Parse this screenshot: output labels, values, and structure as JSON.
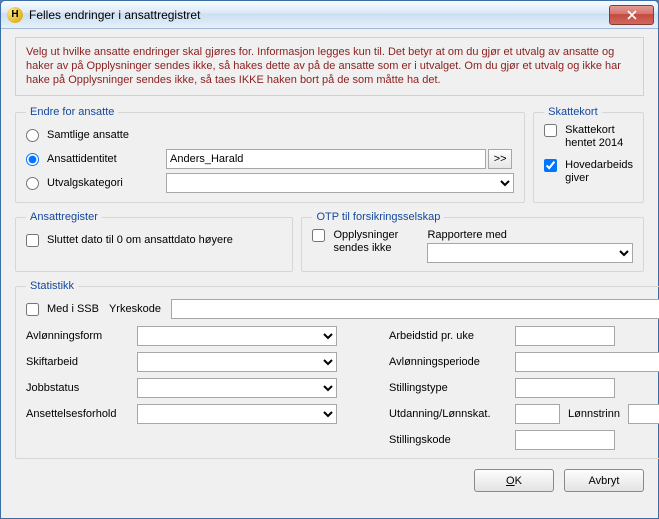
{
  "window": {
    "title": "Felles endringer i ansattregistret",
    "app_icon_letter": "H"
  },
  "info_text": "Velg ut hvilke ansatte endringer skal gjøres for. Informasjon legges kun til. Det betyr at om du gjør et utvalg av ansatte og haker av på Opplysninger sendes ikke, så hakes dette av på de ansatte som er i utvalget. Om du gjør et utvalg og ikke har hake på Opplysninger sendes ikke, så taes IKKE haken bort på de som måtte ha det.",
  "endre_for": {
    "legend": "Endre for ansatte",
    "opt_samtlige": "Samtlige ansatte",
    "opt_ansattid": "Ansattidentitet",
    "opt_utvalg": "Utvalgskategori",
    "ansattid_value": "Anders_Harald",
    "ellipsis": ">>"
  },
  "skattekort": {
    "legend": "Skattekort",
    "hentet_label": "Skattekort hentet 2014",
    "hovedarbeidsgiver_label": "Hovedarbeids giver",
    "hentet_checked": false,
    "hovedarbeidsgiver_checked": true
  },
  "ansattreg": {
    "legend": "Ansattregister",
    "sluttet_label": "Sluttet dato til 0 om ansattdato høyere"
  },
  "otp": {
    "legend": "OTP til forsikringsselskap",
    "opplysninger_label": "Opplysninger sendes ikke",
    "rapportere_label": "Rapportere med"
  },
  "statistikk": {
    "legend": "Statistikk",
    "med_i_ssb": "Med i SSB",
    "yrkeskode": "Yrkeskode",
    "avlonningsform": "Avlønningsform",
    "arbeidstid": "Arbeidstid pr. uke",
    "skiftarbeid": "Skiftarbeid",
    "avlonningsperiode": "Avlønningsperiode",
    "jobbstatus": "Jobbstatus",
    "stillingstype": "Stillingstype",
    "ansettelsesforhold": "Ansettelsesforhold",
    "utdanning": "Utdanning/Lønnskat.",
    "lonnstrinn": "Lønnstrinn",
    "stillingskode": "Stillingskode"
  },
  "footer": {
    "ok_prefix": "O",
    "ok_rest": "K",
    "cancel": "Avbryt"
  }
}
